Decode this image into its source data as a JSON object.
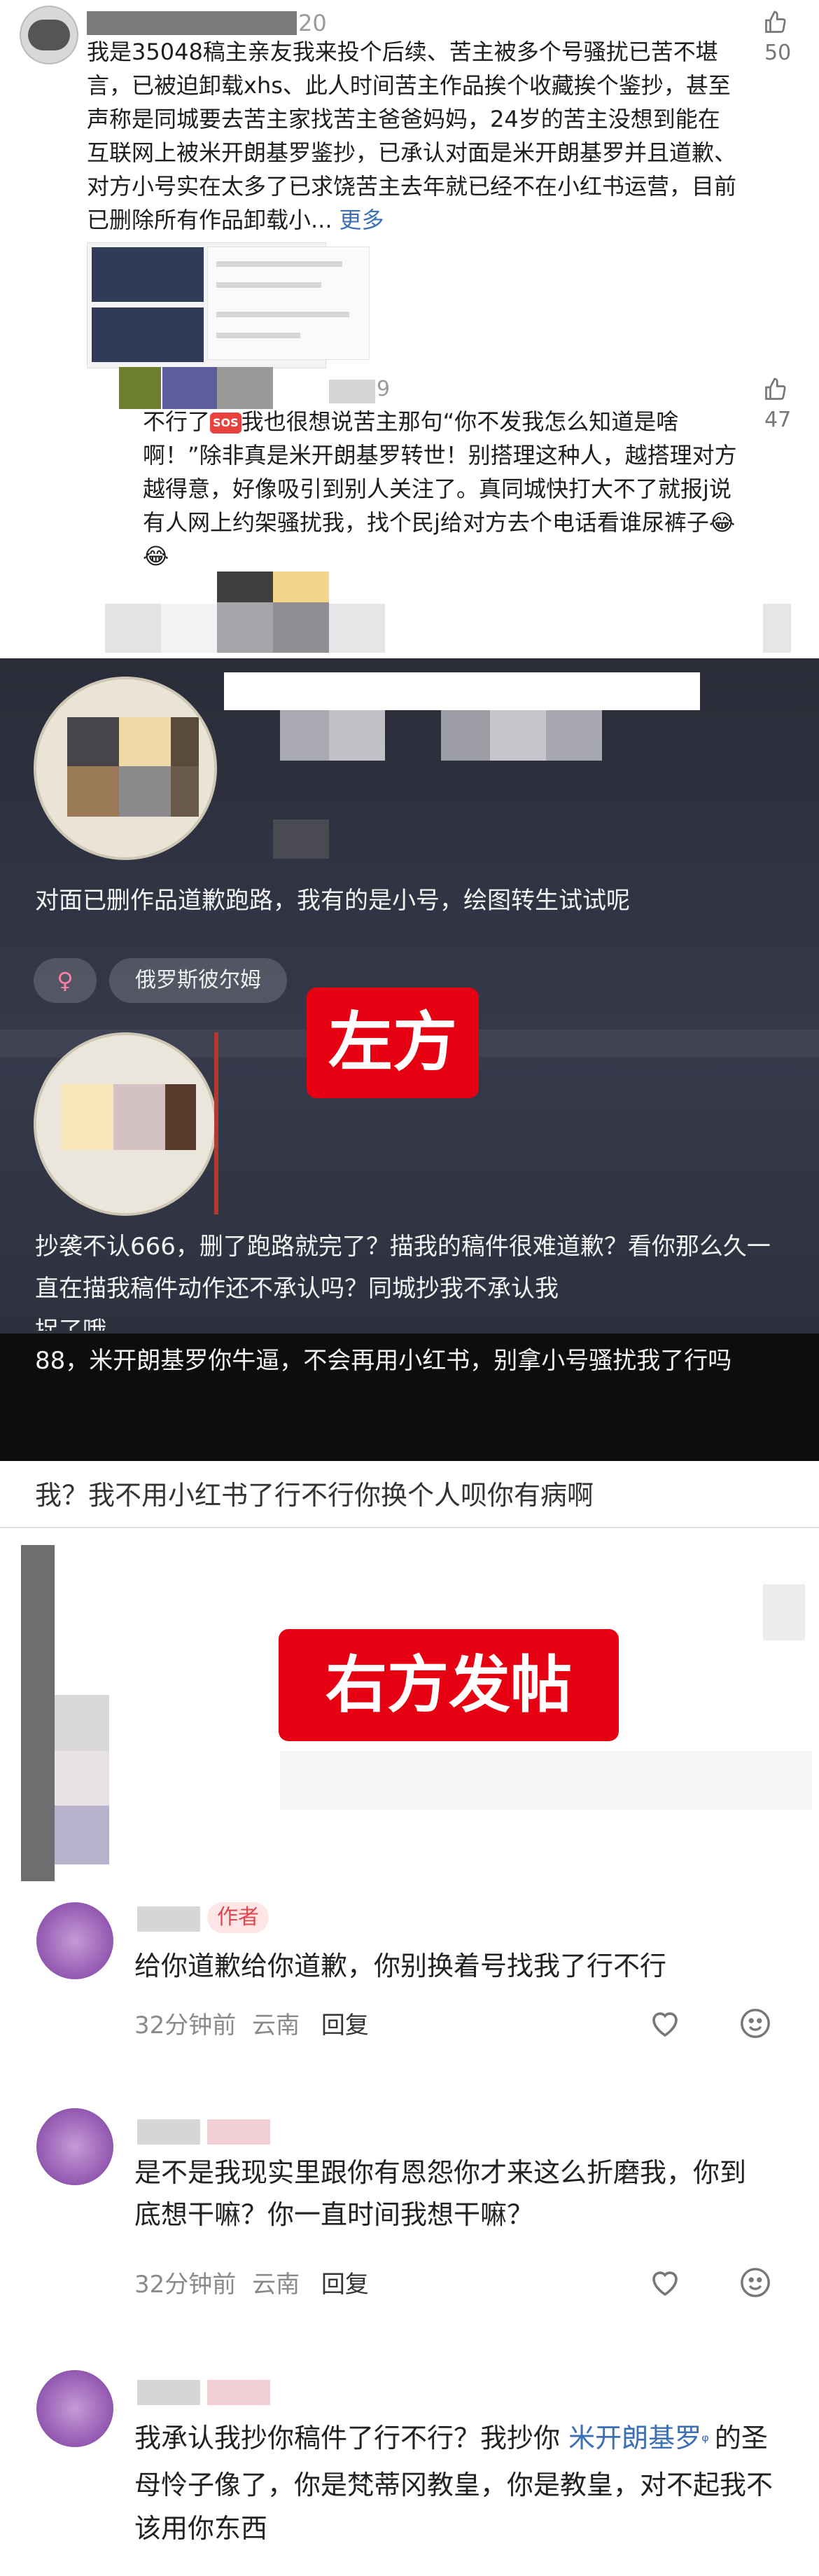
{
  "comment1": {
    "date_suffix": "20",
    "likes": "50",
    "text": "我是35048稿主亲友我来投个后续、苦主被多个号骚扰已苦不堪言，已被迫卸载xhs、此人时间苦主作品挨个收藏挨个鉴抄，甚至声称是同城要去苦主家找苦主爸爸妈妈，24岁的苦主没想到能在互联网上被米开朗基罗鉴抄，已承认对面是米开朗基罗并且道歉、对方小号实在太多了已求饶苦主去年就已经不在小红书运营，目前已删除所有作品卸载小...",
    "more": "更多"
  },
  "comment2": {
    "date_suffix": "9",
    "likes": "47",
    "text_before_emoji": "不行了",
    "sos_badge": "SOS",
    "text_after_emoji": "我也很想说苦主那句“你不发我怎么知道是啥啊！”除非真是米开朗基罗转世！别搭理这种人，越搭理对方越得意，好像吸引到别人关注了。真同城快打大不了就报j说有人网上约架骚扰我，找个民j给对方去个电话看谁尿裤子😂😂"
  },
  "profile": {
    "bio": "对面已删作品道歉跑路，我有的是小号，绘图转生试试呢",
    "gender_symbol": "♀",
    "location_tag": "俄罗斯彼尔姆",
    "label_left": "左方",
    "message1": "抄袭不认666，删了跑路就完了？描我的稿件很难道歉？看你那么久一直在描我稿件动作还不承认吗？同城抄我不承认我",
    "message1_cut": "捉了哦",
    "message2": "88，米开朗基罗你牛逼，不会再用小红书，别拿小号骚扰我了行吗"
  },
  "right_post": {
    "line": "我？我不用小红书了行不行你换个人呗你有病啊",
    "label": "右方发帖"
  },
  "replies": [
    {
      "badge": "作者",
      "text": "给你道歉给你道歉，你别换着号找我了行不行",
      "time": "32分钟前",
      "location": "云南",
      "reply": "回复"
    },
    {
      "badge": "",
      "text": "是不是我现实里跟你有恩怨你才来这么折磨我，你到底想干嘛？你一直时间我想干嘛？",
      "time": "32分钟前",
      "location": "云南",
      "reply": "回复"
    },
    {
      "badge": "",
      "text_before_link": "我承认我抄你稿件了行不行？我抄你 ",
      "link": "米开朗基罗",
      "text_after_link": "的圣母怜子像了，你是梵蒂冈教皇，你是教皇，对不起我不该用你东西"
    }
  ],
  "colors": {
    "accent_red": "#e60012",
    "link_blue": "#3b6fb6",
    "dark_bg": "#2b2d3a"
  }
}
